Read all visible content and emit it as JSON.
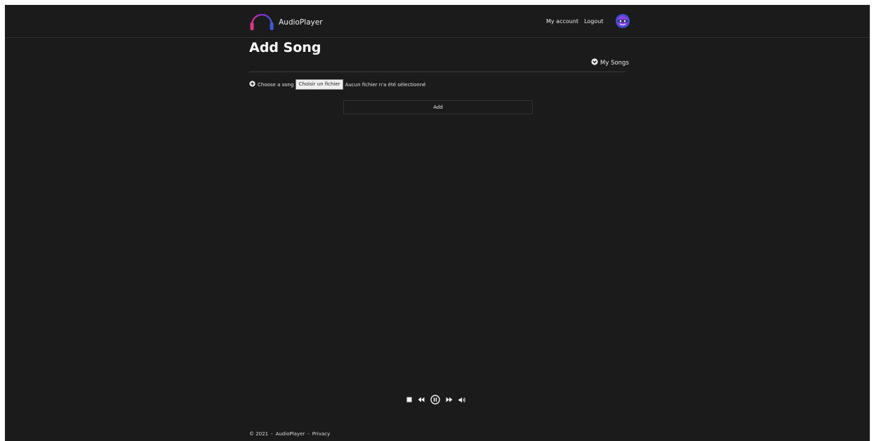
{
  "app": {
    "brand_name": "AudioPlayer",
    "logo_icon": "headphones-waveform-icon",
    "accent_colors": [
      "#e0358a",
      "#8a2be2",
      "#3b5bdb"
    ]
  },
  "nav": {
    "my_account": "My account",
    "logout": "Logout",
    "avatar_icon": "user-avatar-icon"
  },
  "page": {
    "title": "Add Song",
    "my_songs_link": "My Songs"
  },
  "form": {
    "choose_label": "Choose a song",
    "file_button": "Choisir un fichier",
    "file_status": "Aucun fichier n'a été sélectionné",
    "add_button": "Add"
  },
  "player": {
    "controls": [
      "stop-icon",
      "rewind-icon",
      "pause-icon",
      "fast-forward-icon",
      "volume-icon"
    ]
  },
  "footer": {
    "copyright": "© 2021",
    "sep": "-",
    "brand": "AudioPlayer",
    "privacy": "Privacy"
  }
}
